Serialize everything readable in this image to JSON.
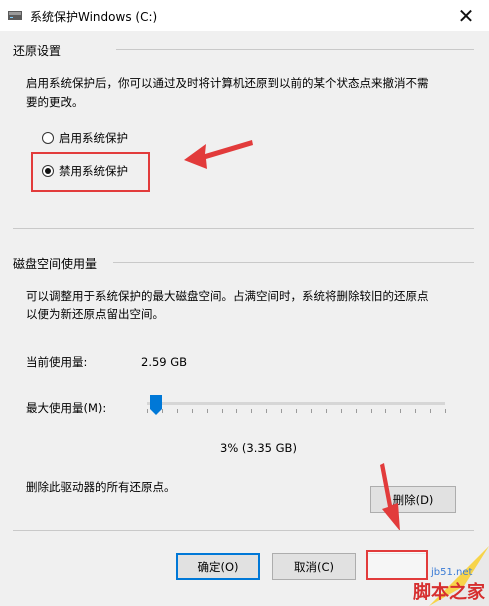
{
  "window": {
    "title": "系统保护Windows (C:)",
    "close_glyph": "✕"
  },
  "restore": {
    "group_label": "还原设置",
    "description_line1": "启用系统保护后，你可以通过及时将计算机还原到以前的某个状态点来撤消不需",
    "description_line2": "要的更改。",
    "option_enable": "启用系统保护",
    "option_disable": "禁用系统保护",
    "selected": "disable"
  },
  "disk": {
    "group_label": "磁盘空间使用量",
    "description_line1": "可以调整用于系统保护的最大磁盘空间。占满空间时，系统将删除较旧的还原点",
    "description_line2": "以便为新还原点留出空间。",
    "current_label": "当前使用量:",
    "current_value": "2.59 GB",
    "max_label": "最大使用量(M):",
    "slider_percent": 3,
    "max_value": "3% (3.35 GB)",
    "delete_text": "删除此驱动器的所有还原点。",
    "delete_button": "删除(D)"
  },
  "footer": {
    "ok": "确定(O)",
    "cancel": "取消(C)"
  },
  "watermark": {
    "site": "jb51.net",
    "brand": "脚本之家"
  },
  "colors": {
    "annotation_red": "#e23b3b",
    "focus_blue": "#0078d7",
    "thumb_blue": "#0078d7"
  }
}
